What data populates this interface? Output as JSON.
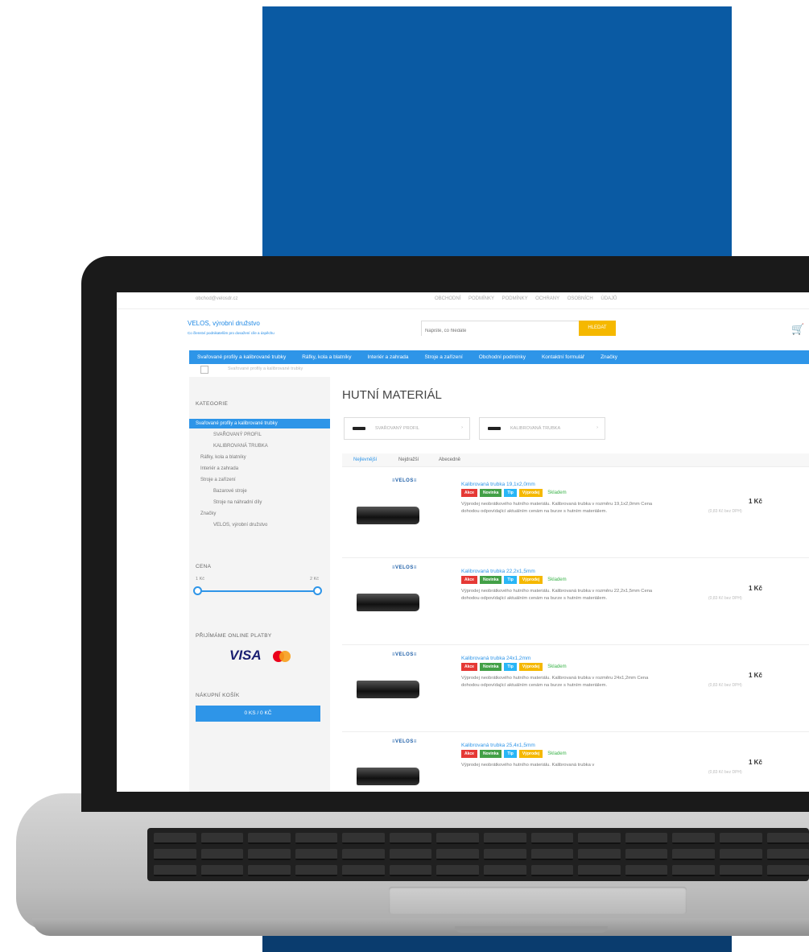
{
  "topbar": {
    "email": "obchod@velosdr.cz",
    "link_terms": "OBCHODNÍ PODMÍNKY",
    "link_privacy": "PODMÍNKY OCHRANY OSOBNÍCH ÚDAJŮ"
  },
  "header": {
    "brand": "VELOS, výrobní družstvo",
    "tagline": "Co členství podnikatelům pro dosažení cíle a úspěchu",
    "search_placeholder": "Napište, co hledáte",
    "search_button": "HLEDAT"
  },
  "nav": {
    "items": [
      "Svařované profily a kalibrované trubky",
      "Ráfky, kola a blatníky",
      "Interiér a zahrada",
      "Stroje a zařízení",
      "Obchodní podmínky",
      "Kontaktní formulář",
      "Značky"
    ]
  },
  "breadcrumb": {
    "current": "Svařované profily a kalibrované trubky"
  },
  "sidebar": {
    "categories_heading": "KATEGORIE",
    "active_category": "Svařované profily a kalibrované trubky",
    "categories": [
      "SVAŘOVANÝ PROFIL",
      "KALIBROVANÁ TRUBKA",
      "Ráfky, kola a blatníky",
      "Interiér a zahrada",
      "Stroje a zařízení",
      "Bazarové stroje",
      "Stroje na náhradní díly",
      "Značky",
      "VELOS, výrobní družstvo"
    ],
    "price_heading": "CENA",
    "price_min": "1 Kč",
    "price_max": "2 Kč",
    "payments_heading": "PŘIJÍMÁME ONLINE PLATBY",
    "visa": "VISA",
    "cart_heading": "NÁKUPNÍ KOŠÍK",
    "cart_button": "0 KS / 0 KČ"
  },
  "main": {
    "title": "HUTNÍ MATERIÁL",
    "subcategories": [
      "SVAŘOVANÝ PROFIL",
      "KALIBROVANÁ TRUBKA"
    ],
    "tabs": [
      "Nejlevnější",
      "Nejdražší",
      "Abecedně"
    ],
    "brand_label": "≡VELOS≡",
    "badges": {
      "akce": "Akce",
      "novinka": "Novinka",
      "tip": "Tip",
      "vyprodej": "Výprodej",
      "stock": "Skladem"
    },
    "products": [
      {
        "name": "Kalibrovaná trubka 19,1x2,0mm",
        "desc": "Výprodej neobrátkového hutního materiálu.  Kalibrovaná trubka v rozměru 19,1x2,0mm Cena dohodou odpovídající aktuálním cenám na burze s hutním materiálem.",
        "price": "1 Kč",
        "vat": "(0,83 Kč bez DPH)"
      },
      {
        "name": "Kalibrovaná trubka 22,2x1,5mm",
        "desc": "Výprodej neobrátkového hutního materiálu.  Kalibrovaná trubka v rozměru 22,2x1,5mm Cena dohodou odpovídající aktuálním cenám na burze s hutním materiálem.",
        "price": "1 Kč",
        "vat": "(0,83 Kč bez DPH)"
      },
      {
        "name": "Kalibrovaná trubka 24x1,2mm",
        "desc": "Výprodej neobrátkového hutního materiálu.  Kalibrovaná trubka v rozměru 24x1,2mm Cena dohodou odpovídající aktuálním cenám na burze s hutním materiálem.",
        "price": "1 Kč",
        "vat": "(0,83 Kč bez DPH)"
      },
      {
        "name": "Kalibrovaná trubka 25,4x1,5mm",
        "desc": "Výprodej neobrátkového hutního materiálu.  Kalibrovaná trubka v",
        "price": "1 Kč",
        "vat": "(0,83 Kč bez DPH)"
      }
    ]
  },
  "colors": {
    "accent": "#2e95e8",
    "brand_blue": "#0a5aa3",
    "search_button": "#f5b800",
    "akce": "#e53935",
    "novinka": "#43a047",
    "tip": "#29b6f6",
    "vyprodej": "#f5b800"
  }
}
